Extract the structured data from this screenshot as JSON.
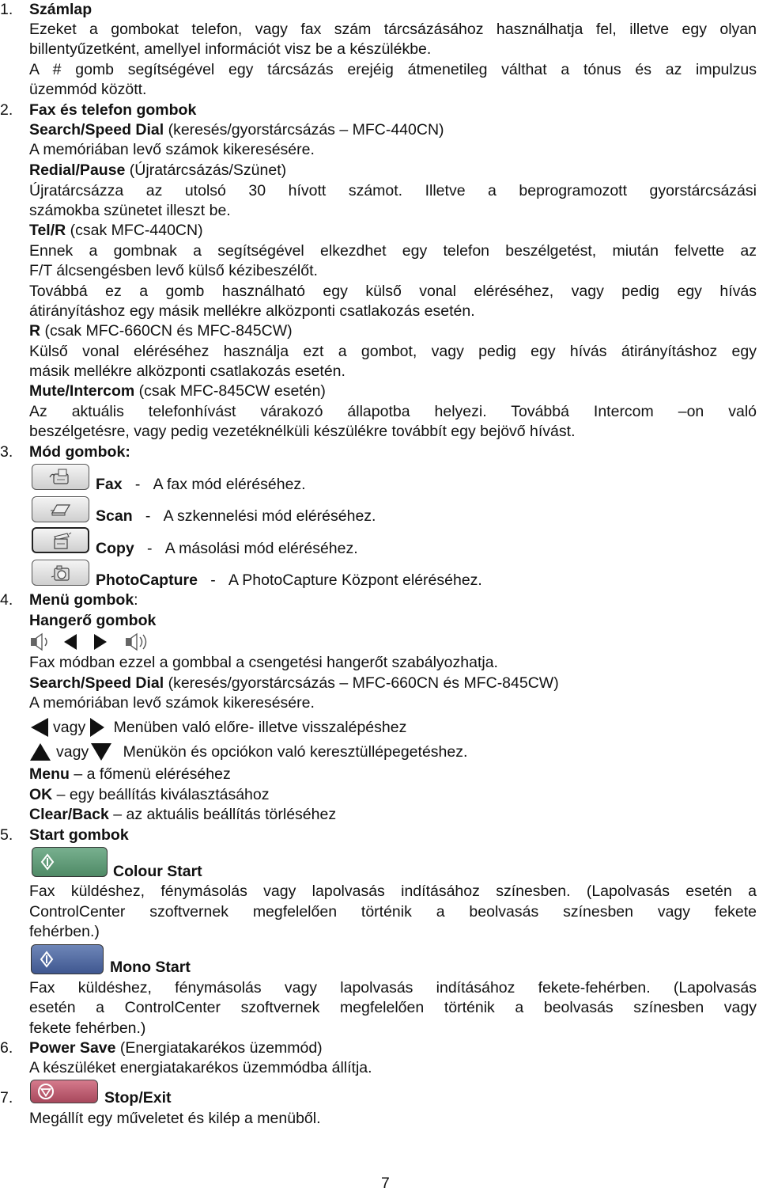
{
  "sections": {
    "s1": {
      "num": "1.",
      "title": "Számlap",
      "lines": [
        "Ezeket a gombokat telefon, vagy fax szám tárcsázásához használhatja fel, illetve egy olyan",
        "billentyűzetként, amellyel információt visz be a készülékbe.",
        "A # gomb segítségével egy tárcsázás erejéig átmenetileg válthat a tónus és az impulzus",
        "üzemmód között."
      ]
    },
    "s2": {
      "num": "2.",
      "title": "Fax és telefon gombok",
      "search_bold": "Search/Speed Dial",
      "search_rest": " (keresés/gyorstárcsázás – MFC-440CN)",
      "search_desc": "A memóriában levő számok kikeresésére.",
      "redial_bold": "Redial/Pause",
      "redial_rest": " (Újratárcsázás/Szünet)",
      "redial_lines": [
        "Újratárcsázza az utolsó 30 hívott számot. Illetve a beprogramozott gyorstárcsázási",
        "számokba szünetet illeszt be."
      ],
      "telr_bold": "Tel/R",
      "telr_rest": " (csak MFC-440CN)",
      "telr_lines": [
        "Ennek a gombnak a segítségével elkezdhet egy telefon beszélgetést, miután felvette az",
        "F/T álcsengésben levő külső kézibeszélőt.",
        "Továbbá ez a gomb használható egy külső vonal eléréséhez, vagy pedig egy hívás",
        "átirányításhoz egy másik mellékre alközponti csatlakozás esetén."
      ],
      "r_bold": "R",
      "r_rest": " (csak MFC-660CN és MFC-845CW)",
      "r_lines": [
        "Külső vonal eléréséhez használja ezt a gombot, vagy pedig egy hívás átirányításhoz egy",
        "másik mellékre alközponti csatlakozás esetén."
      ],
      "mute_bold": "Mute/Intercom",
      "mute_rest": " (csak MFC-845CW esetén)",
      "mute_lines": [
        "Az aktuális telefonhívást várakozó állapotba helyezi. Továbbá Intercom –on való",
        "beszélgetésre, vagy pedig vezetéknélküli készülékre továbbít egy bejövő hívást."
      ]
    },
    "s3": {
      "num": "3.",
      "title": "Mód gombok:",
      "modes": [
        {
          "name": "Fax",
          "sep": "-",
          "desc": "A fax mód eléréséhez.",
          "icon": "fax-icon"
        },
        {
          "name": "Scan",
          "sep": "-",
          "desc": "A szkennelési mód eléréséhez.",
          "icon": "scanner-icon"
        },
        {
          "name": "Copy",
          "sep": "-",
          "desc": "A másolási mód eléréséhez.",
          "icon": "copier-icon"
        },
        {
          "name": "PhotoCapture",
          "sep": "-",
          "desc": "A PhotoCapture Központ eléréséhez.",
          "icon": "camera-icon"
        }
      ]
    },
    "s4": {
      "num": "4.",
      "title": "Menü gombok",
      "title_colon": ":",
      "volume_title": "Hangerő gombok",
      "volume_desc": "Fax módban ezzel a gombbal a csengetési hangerőt szabályozhatja.",
      "search_bold": "Search/Speed Dial",
      "search_rest": " (keresés/gyorstárcsázás – MFC-660CN és MFC-845CW)",
      "search_desc": "A memóriában levő számok kikeresésére.",
      "lr_or": "vagy",
      "lr_desc": "Menüben való előre- illetve visszalépéshez",
      "ud_or": "vagy",
      "ud_desc": "Menükön és opciókon való keresztüllépegetéshez.",
      "menu_bold": "Menu",
      "menu_rest": " – a főmenü eléréséhez",
      "ok_bold": "OK",
      "ok_rest": " – egy beállítás kiválasztásához",
      "clear_bold": "Clear/Back",
      "clear_rest": " – az aktuális beállítás törléséhez"
    },
    "s5": {
      "num": "5.",
      "title": "Start gombok",
      "colour_label": "Colour Start",
      "colour_color": "#5f9a76",
      "colour_lines": [
        "Fax küldéshez, fénymásolás vagy lapolvasás indításához színesben. (Lapolvasás esetén a",
        "ControlCenter szoftvernek megfelelően történik a beolvasás színesben vagy fekete",
        "fehérben.)"
      ],
      "mono_label": "Mono Start",
      "mono_color": "#5068a2",
      "mono_lines": [
        "Fax küldéshez, fénymásolás vagy lapolvasás indításához fekete-fehérben. (Lapolvasás",
        "esetén a ControlCenter szoftvernek megfelelően történik a beolvasás színesben vagy",
        "fekete fehérben.)"
      ]
    },
    "s6": {
      "num": "6.",
      "title": "Power Save",
      "title_rest": " (Energiatakarékos üzemmód)",
      "desc": "A készüléket energiatakarékos üzemmódba állítja."
    },
    "s7": {
      "num": "7.",
      "title": "Stop/Exit",
      "stop_color": "#b85b6e",
      "desc": "Megállít egy műveletet és kilép a menüből."
    }
  },
  "page_number": "7"
}
